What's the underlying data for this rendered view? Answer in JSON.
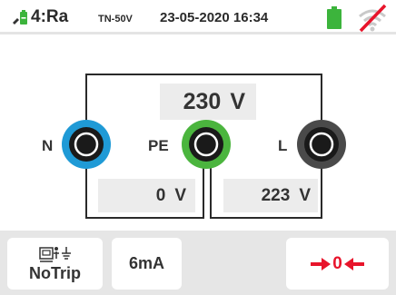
{
  "status": {
    "mode": "4:Ra",
    "system": "TN-50V",
    "datetime": "23-05-2020 16:34"
  },
  "colors": {
    "neutral_ring": "#1f9ad6",
    "pe_ring": "#4bb53e",
    "line_ring": "#4a4a4a",
    "battery": "#3cb43c",
    "accent_red": "#e8142b"
  },
  "measurements": {
    "main": {
      "value": "230",
      "unit": "V"
    },
    "n_pe": {
      "value": "0",
      "unit": "V"
    },
    "pe_l": {
      "value": "223",
      "unit": "V"
    }
  },
  "terminals": {
    "n": "N",
    "pe": "PE",
    "l": "L"
  },
  "buttons": {
    "notrip": "NoTrip",
    "current": "6mA",
    "zero": "0"
  },
  "icons": {
    "probe": "probe-battery-icon",
    "battery": "battery-icon",
    "wifi": "wifi-off-icon",
    "notrip": "rcd-earth-icon",
    "zero": "zero-arrows-icon"
  }
}
